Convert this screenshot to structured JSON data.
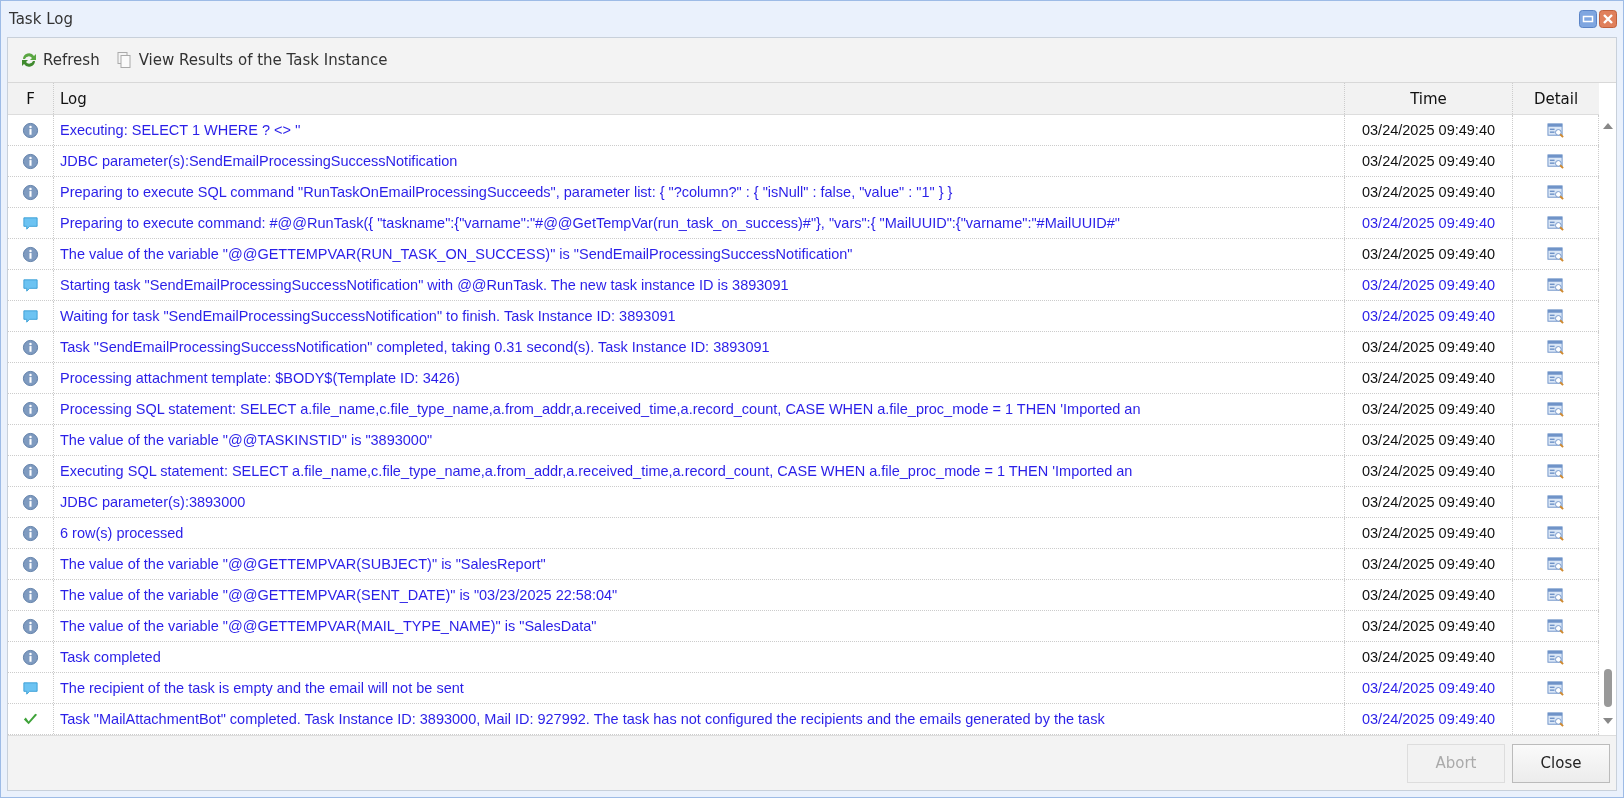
{
  "window": {
    "title": "Task Log"
  },
  "toolbar": [
    {
      "kind": "refresh",
      "label": "Refresh"
    },
    {
      "kind": "view",
      "label": "View Results of the Task Instance"
    }
  ],
  "table": {
    "columns": [
      "F",
      "Log",
      "Time",
      "Detail"
    ],
    "rows": [
      {
        "kind": "info",
        "log": "Executing: SELECT 1 WHERE ? <> ''",
        "time": "03/24/2025 09:49:40"
      },
      {
        "kind": "info",
        "log": "JDBC parameter(s):SendEmailProcessingSuccessNotification",
        "time": "03/24/2025 09:49:40"
      },
      {
        "kind": "info",
        "log": "Preparing to execute SQL command \"RunTaskOnEmailProcessingSucceeds\", parameter list: { \"?column?\" : { \"isNull\" : false, \"value\" : \"1\" } }",
        "time": "03/24/2025 09:49:40"
      },
      {
        "kind": "message",
        "log": "Preparing to execute command: #@@RunTask({ \"taskname\":{\"varname\":\"#@@GetTempVar(run_task_on_success)#\"}, \"vars\":{ \"MailUUID\":{\"varname\":\"#MailUUID#\"",
        "time": "03/24/2025 09:49:40"
      },
      {
        "kind": "info",
        "log": "The value of the variable \"@@GETTEMPVAR(RUN_TASK_ON_SUCCESS)\" is \"SendEmailProcessingSuccessNotification\"",
        "time": "03/24/2025 09:49:40"
      },
      {
        "kind": "message",
        "log": "Starting task \"SendEmailProcessingSuccessNotification\" with @@RunTask. The new task instance ID is 3893091",
        "time": "03/24/2025 09:49:40"
      },
      {
        "kind": "message",
        "log": "Waiting for task \"SendEmailProcessingSuccessNotification\" to finish. Task Instance ID: 3893091",
        "time": "03/24/2025 09:49:40"
      },
      {
        "kind": "info",
        "log": "Task \"SendEmailProcessingSuccessNotification\" completed, taking 0.31 second(s). Task Instance ID: 3893091",
        "time": "03/24/2025 09:49:40"
      },
      {
        "kind": "info",
        "log": "Processing attachment template: $BODY$(Template ID: 3426)",
        "time": "03/24/2025 09:49:40"
      },
      {
        "kind": "info",
        "log": "Processing SQL statement: SELECT a.file_name,c.file_type_name,a.from_addr,a.received_time,a.record_count, CASE WHEN a.file_proc_mode = 1 THEN 'Imported an",
        "time": "03/24/2025 09:49:40"
      },
      {
        "kind": "info",
        "log": "The value of the variable \"@@TASKINSTID\" is \"3893000\"",
        "time": "03/24/2025 09:49:40"
      },
      {
        "kind": "info",
        "log": "Executing SQL statement: SELECT a.file_name,c.file_type_name,a.from_addr,a.received_time,a.record_count, CASE WHEN a.file_proc_mode = 1 THEN 'Imported an",
        "time": "03/24/2025 09:49:40"
      },
      {
        "kind": "info",
        "log": "JDBC parameter(s):3893000",
        "time": "03/24/2025 09:49:40"
      },
      {
        "kind": "info",
        "log": "6 row(s) processed",
        "time": "03/24/2025 09:49:40"
      },
      {
        "kind": "info",
        "log": "The value of the variable \"@@GETTEMPVAR(SUBJECT)\" is \"SalesReport\"",
        "time": "03/24/2025 09:49:40"
      },
      {
        "kind": "info",
        "log": "The value of the variable \"@@GETTEMPVAR(SENT_DATE)\" is \"03/23/2025 22:58:04\"",
        "time": "03/24/2025 09:49:40"
      },
      {
        "kind": "info",
        "log": "The value of the variable \"@@GETTEMPVAR(MAIL_TYPE_NAME)\" is \"SalesData\"",
        "time": "03/24/2025 09:49:40"
      },
      {
        "kind": "info",
        "log": "Task completed",
        "time": "03/24/2025 09:49:40"
      },
      {
        "kind": "message",
        "log": "The recipient of the task is empty and the email will not be sent",
        "time": "03/24/2025 09:49:40"
      },
      {
        "kind": "success",
        "log": "Task \"MailAttachmentBot\" completed. Task Instance ID: 3893000, Mail ID: 927992. The task has not configured the recipients and the emails generated by the task",
        "time": "03/24/2025 09:49:40"
      }
    ]
  },
  "buttons": [
    {
      "label": "Abort",
      "disabled": true
    },
    {
      "label": "Close",
      "disabled": false
    }
  ]
}
